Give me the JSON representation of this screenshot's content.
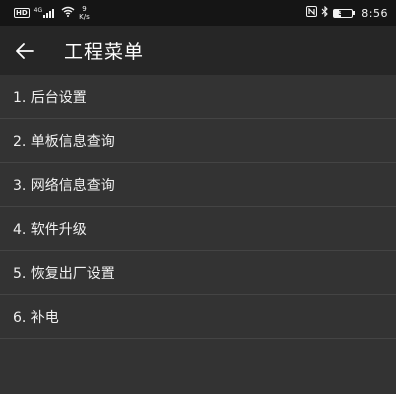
{
  "status_bar": {
    "hd_badge": "HD",
    "signal_type": "4G",
    "net_speed_value": "9",
    "net_speed_unit": "K/s",
    "battery_level": "37",
    "time": "8:56",
    "icons": [
      "hd-icon",
      "signal-icon",
      "wifi-icon",
      "nfc-icon",
      "bluetooth-icon",
      "battery-icon"
    ]
  },
  "header": {
    "title": "工程菜单",
    "back_icon": "arrow-left-icon"
  },
  "menu": {
    "items": [
      {
        "label": "1. 后台设置"
      },
      {
        "label": "2. 单板信息查询"
      },
      {
        "label": "3. 网络信息查询"
      },
      {
        "label": "4. 软件升级"
      },
      {
        "label": "5. 恢复出厂设置"
      },
      {
        "label": "6. 补电"
      }
    ]
  },
  "colors": {
    "status_bar_bg": "#151515",
    "app_bar_bg": "#262626",
    "list_bg": "#333333",
    "divider": "#444444",
    "text": "#ffffff"
  }
}
